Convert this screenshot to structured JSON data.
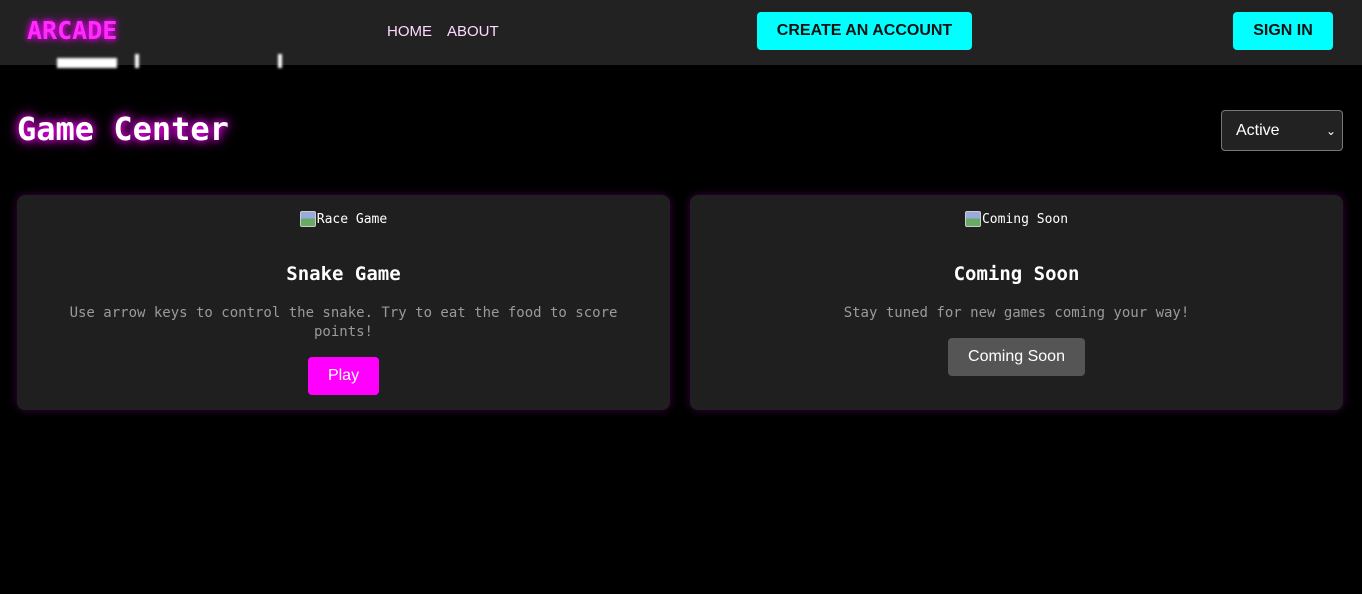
{
  "navbar": {
    "logo": "ARCADE",
    "links": [
      "HOME",
      "ABOUT"
    ],
    "create_account_label": "CREATE AN ACCOUNT",
    "sign_in_label": "SIGN IN"
  },
  "main": {
    "title": "Game Center",
    "filter": {
      "selected": "Active"
    },
    "games": [
      {
        "image_alt": "Race Game",
        "title": "Snake Game",
        "description": "Use arrow keys to control the snake. Try to eat the food to score points!",
        "button_label": "Play"
      },
      {
        "image_alt": "Coming Soon",
        "title": "Coming Soon",
        "description": "Stay tuned for new games coming your way!",
        "button_label": "Coming Soon"
      }
    ]
  },
  "colors": {
    "accent_magenta": "#ff00ff",
    "accent_cyan": "#00ffff",
    "navbar_bg": "#222222",
    "card_bg": "#1f1f1f",
    "disabled_button": "#555555"
  }
}
